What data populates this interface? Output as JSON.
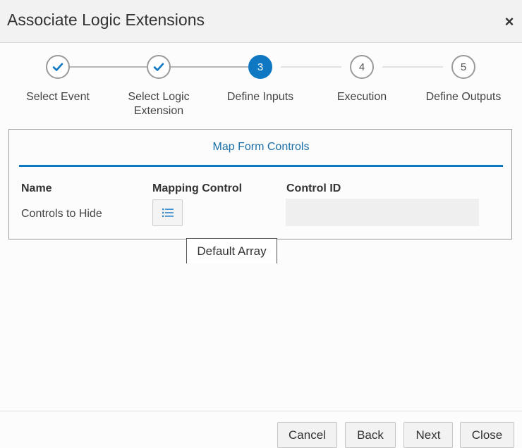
{
  "dialog": {
    "title": "Associate Logic Extensions",
    "close_glyph": "×"
  },
  "wizard": {
    "steps": [
      {
        "number": "1",
        "label": "Select Event",
        "state": "done"
      },
      {
        "number": "2",
        "label": "Select Logic Extension",
        "state": "done"
      },
      {
        "number": "3",
        "label": "Define Inputs",
        "state": "current"
      },
      {
        "number": "4",
        "label": "Execution",
        "state": "todo"
      },
      {
        "number": "5",
        "label": "Define Outputs",
        "state": "todo"
      }
    ]
  },
  "panel": {
    "tab_label": "Map Form Controls",
    "columns": {
      "name": "Name",
      "mapping": "Mapping Control",
      "control_id": "Control ID"
    },
    "rows": [
      {
        "name": "Controls to Hide",
        "control_id": ""
      }
    ],
    "tooltip": "Default Array"
  },
  "footer": {
    "cancel": "Cancel",
    "back": "Back",
    "next": "Next",
    "close": "Close"
  },
  "colors": {
    "accent": "#0f78c3",
    "tab_text": "#1a6fa8"
  }
}
